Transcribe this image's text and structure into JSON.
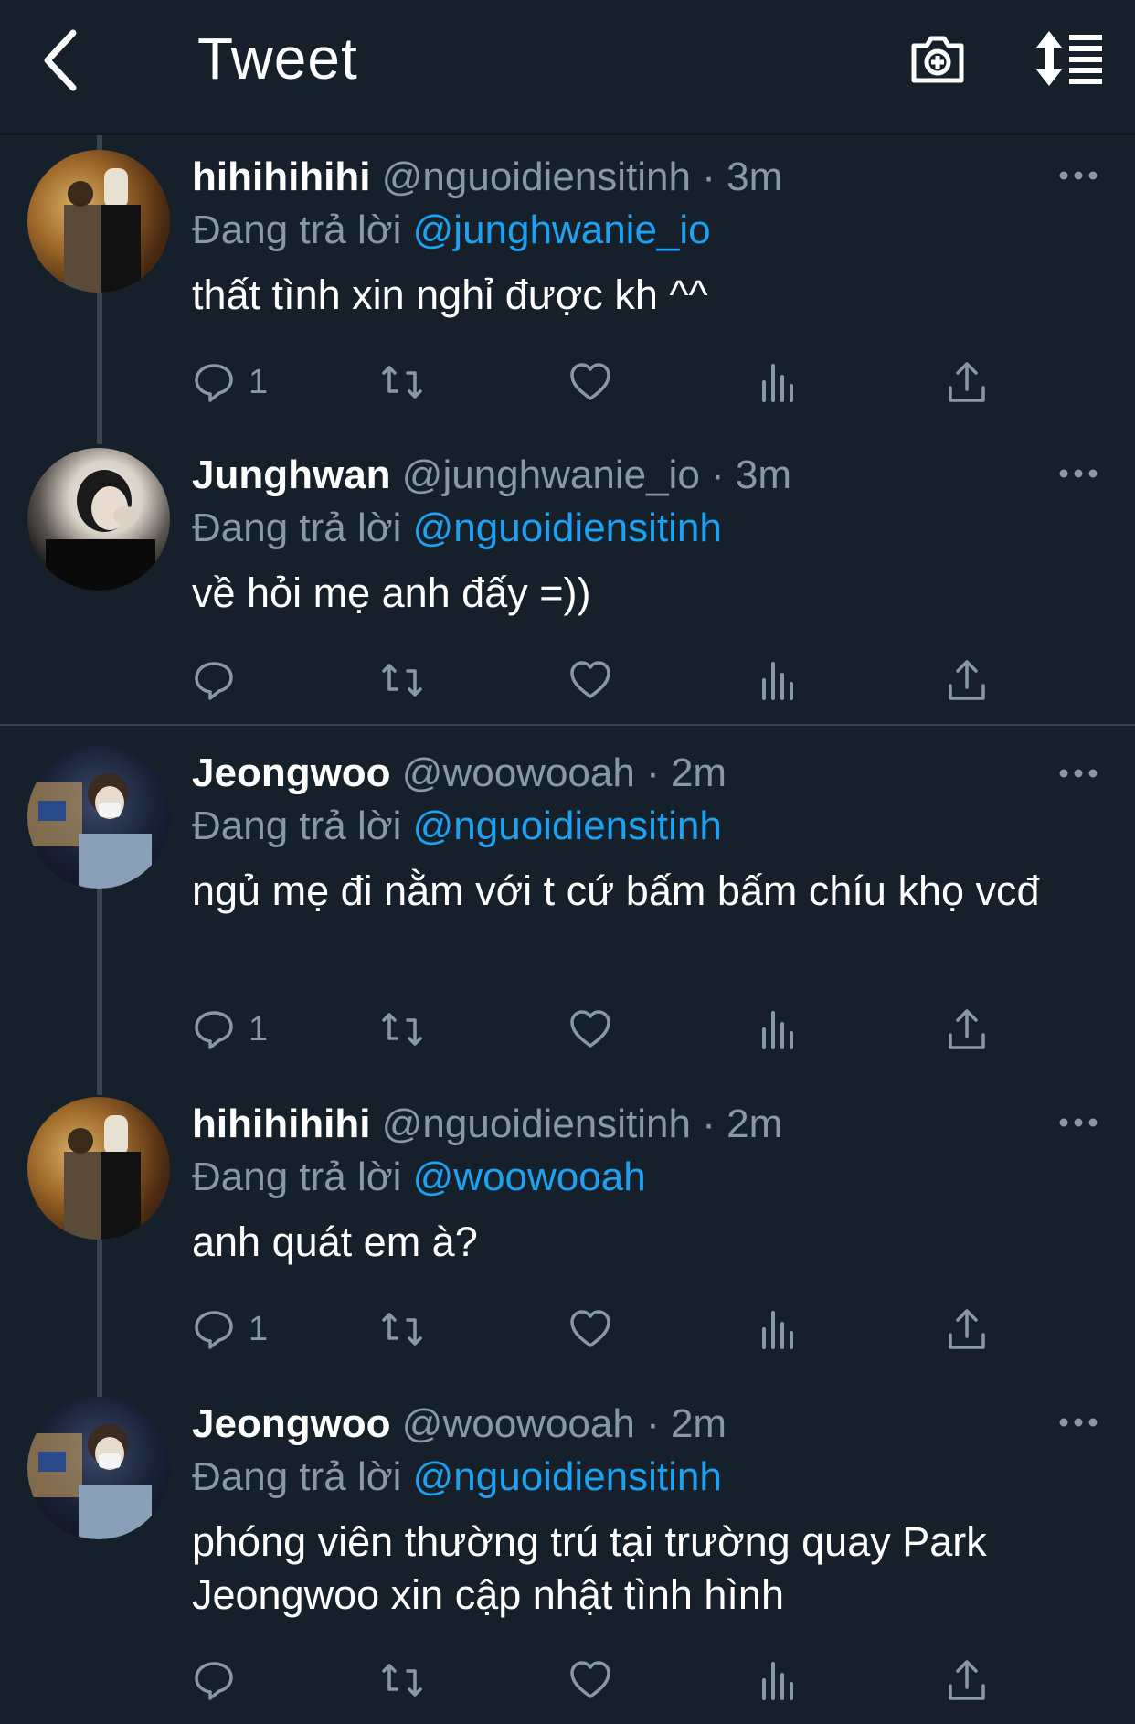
{
  "header": {
    "title": "Tweet",
    "back_icon": "chevron-left-icon",
    "camera_icon": "camera-plus-icon",
    "sort_icon": "sort-list-icon"
  },
  "tweets": [
    {
      "name": "hihihihihi",
      "handle": "@nguoidiensitinh",
      "time": "· 3m",
      "reply_prefix": "Đang trả lời",
      "reply_to": "@junghwanie_io",
      "text": "thất tình xin nghỉ được kh ^^",
      "reply_count": "1"
    },
    {
      "name": "Junghwan",
      "handle": "@junghwanie_io",
      "time": "· 3m",
      "reply_prefix": "Đang trả lời",
      "reply_to": "@nguoidiensitinh",
      "text": "về hỏi mẹ anh đấy =))",
      "reply_count": ""
    },
    {
      "name": "Jeongwoo",
      "handle": "@woowooah",
      "time": "· 2m",
      "reply_prefix": "Đang trả lời",
      "reply_to": "@nguoidiensitinh",
      "text": "ngủ mẹ đi nằm với t cứ bấm bấm chíu khọ vcđ",
      "reply_count": "1"
    },
    {
      "name": "hihihihihi",
      "handle": "@nguoidiensitinh",
      "time": "· 2m",
      "reply_prefix": "Đang trả lời",
      "reply_to": "@woowooah",
      "text": "anh quát em à?",
      "reply_count": "1"
    },
    {
      "name": "Jeongwoo",
      "handle": "@woowooah",
      "time": "· 2m",
      "reply_prefix": "Đang trả lời",
      "reply_to": "@nguoidiensitinh",
      "text": "phóng viên thường trú tại trường quay Park Jeongwoo xin cập nhật tình hình",
      "reply_count": ""
    }
  ],
  "colors": {
    "background": "#15202b",
    "muted": "#8899a6",
    "link": "#1da1f2",
    "line": "#38444d"
  }
}
